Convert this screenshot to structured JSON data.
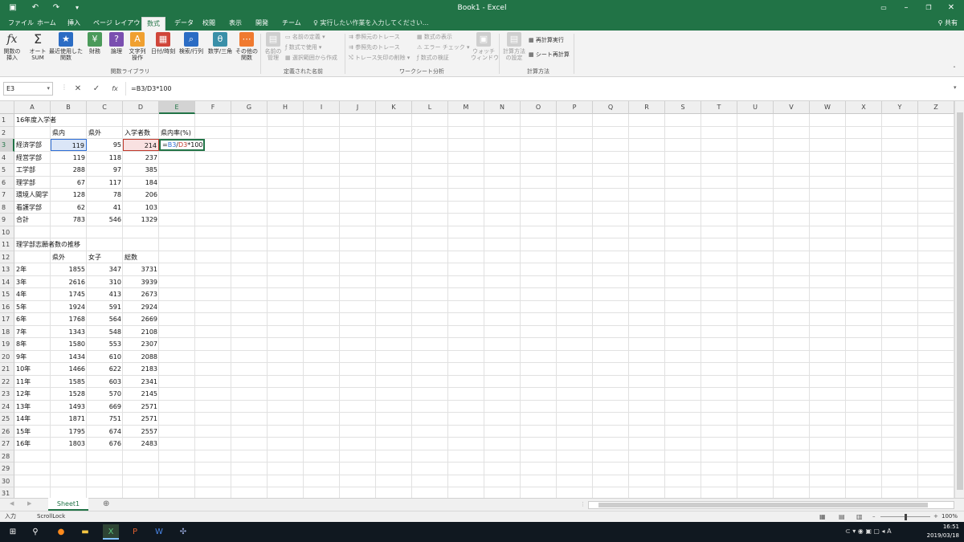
{
  "titlebar": {
    "title": "Book1 - Excel",
    "save_icon": "save-icon",
    "undo_icon": "undo-icon",
    "redo_icon": "redo-icon"
  },
  "tabs": {
    "items": [
      "ファイル",
      "ホーム",
      "挿入",
      "ページ レイアウト",
      "数式",
      "データ",
      "校閲",
      "表示",
      "開発",
      "チーム"
    ],
    "active": "数式",
    "tellme": "実行したい作業を入力してください...",
    "share": "共有"
  },
  "ribbon": {
    "function_library": {
      "label": "関数ライブラリ",
      "insert_function": "関数の\n挿入",
      "autosum": "オート\nSUM",
      "recent": "最近使用した\n関数",
      "financial": "財務",
      "logical": "論理",
      "text": "文字列\n操作",
      "datetime": "日付/時刻",
      "lookup": "検索/行列",
      "math": "数学/三角",
      "more": "その他の\n関数"
    },
    "defined_names": {
      "label": "定義された名前",
      "name_manager": "名前の\n管理",
      "define_name": "名前の定義",
      "use_in_formula": "数式で使用",
      "create_from_selection": "選択範囲から作成"
    },
    "formula_auditing": {
      "label": "ワークシート分析",
      "trace_precedents": "参照元のトレース",
      "trace_dependents": "参照先のトレース",
      "remove_arrows": "トレース矢印の削除",
      "show_formulas": "数式の表示",
      "error_checking": "エラー チェック",
      "evaluate_formula": "数式の検証",
      "watch_window": "ウォッチ\nウィンドウ"
    },
    "calculation": {
      "label": "計算方法",
      "options": "計算方法\nの設定",
      "calc_now": "再計算実行",
      "calc_sheet": "シート再計算"
    }
  },
  "formula_bar": {
    "name_box": "E3",
    "formula": "=B3/D3*100",
    "cancel": "✕",
    "enter": "✓",
    "fx": "fx"
  },
  "columns": [
    "A",
    "B",
    "C",
    "D",
    "E",
    "F",
    "G",
    "H",
    "I",
    "J",
    "K",
    "L",
    "M",
    "N",
    "O",
    "P",
    "Q",
    "R",
    "S",
    "T",
    "U",
    "V",
    "W",
    "X",
    "Y",
    "Z"
  ],
  "rows": [
    "1",
    "2",
    "3",
    "4",
    "5",
    "6",
    "7",
    "8",
    "9",
    "10",
    "11",
    "12",
    "13",
    "14",
    "15",
    "16",
    "17",
    "18",
    "19",
    "20",
    "21",
    "22",
    "23",
    "24",
    "25",
    "26",
    "27",
    "28",
    "29",
    "30",
    "31"
  ],
  "table1": {
    "title": "16年度入学者",
    "headers": [
      "県内",
      "県外",
      "入学者数",
      "県内率(%)"
    ],
    "rows": [
      {
        "name": "経済学部",
        "b": "119",
        "c": "95",
        "d": "214"
      },
      {
        "name": "経営学部",
        "b": "119",
        "c": "118",
        "d": "237"
      },
      {
        "name": "工学部",
        "b": "288",
        "c": "97",
        "d": "385"
      },
      {
        "name": "理学部",
        "b": "67",
        "c": "117",
        "d": "184"
      },
      {
        "name": "環境人間学",
        "b": "128",
        "c": "78",
        "d": "206"
      },
      {
        "name": "看護学部",
        "b": "62",
        "c": "41",
        "d": "103"
      },
      {
        "name": "合計",
        "b": "783",
        "c": "546",
        "d": "1329"
      }
    ],
    "editing": "=B3/D3*100"
  },
  "table2": {
    "title": "理学部志願者数の推移",
    "headers": [
      "県外",
      "女子",
      "総数"
    ],
    "rows": [
      {
        "year": "2年",
        "b": "1855",
        "c": "347",
        "d": "3731"
      },
      {
        "year": "3年",
        "b": "2616",
        "c": "310",
        "d": "3939"
      },
      {
        "year": "4年",
        "b": "1745",
        "c": "413",
        "d": "2673"
      },
      {
        "year": "5年",
        "b": "1924",
        "c": "591",
        "d": "2924"
      },
      {
        "year": "6年",
        "b": "1768",
        "c": "564",
        "d": "2669"
      },
      {
        "year": "7年",
        "b": "1343",
        "c": "548",
        "d": "2108"
      },
      {
        "year": "8年",
        "b": "1580",
        "c": "553",
        "d": "2307"
      },
      {
        "year": "9年",
        "b": "1434",
        "c": "610",
        "d": "2088"
      },
      {
        "year": "10年",
        "b": "1466",
        "c": "622",
        "d": "2183"
      },
      {
        "year": "11年",
        "b": "1585",
        "c": "603",
        "d": "2341"
      },
      {
        "year": "12年",
        "b": "1528",
        "c": "570",
        "d": "2145"
      },
      {
        "year": "13年",
        "b": "1493",
        "c": "669",
        "d": "2571"
      },
      {
        "year": "14年",
        "b": "1871",
        "c": "751",
        "d": "2571"
      },
      {
        "year": "15年",
        "b": "1795",
        "c": "674",
        "d": "2557"
      },
      {
        "year": "16年",
        "b": "1803",
        "c": "676",
        "d": "2483"
      }
    ]
  },
  "sheet_tabs": {
    "active": "Sheet1",
    "add": "⊕"
  },
  "status": {
    "mode": "入力",
    "scroll_lock": "ScrollLock",
    "zoom": "100%"
  },
  "taskbar": {
    "time": "16:51",
    "date": "2019/03/18",
    "ime": "A"
  },
  "colors": {
    "excel_green": "#217346",
    "ref_blue": "#2f6fd6",
    "ref_red": "#c0392b"
  }
}
